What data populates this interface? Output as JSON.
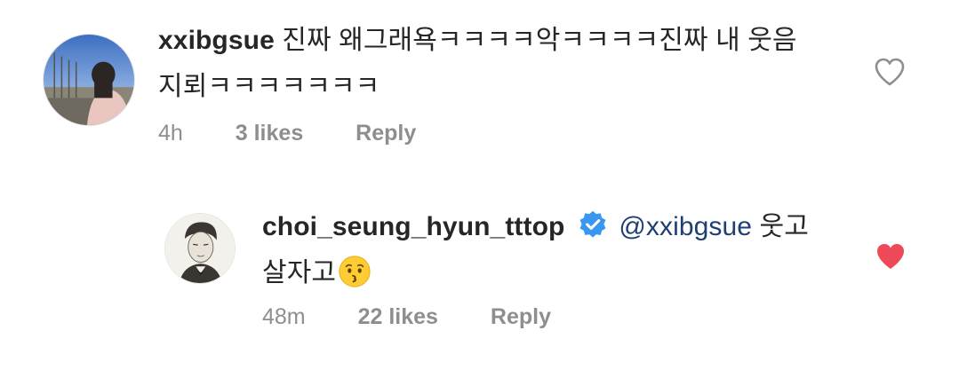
{
  "comments": [
    {
      "username": "xxibgsue",
      "text_line1": "진짜 왜그래욕ㅋㅋㅋㅋ악ㅋㅋㅋㅋ진짜 내 웃음",
      "text_line2": "지뢰ㅋㅋㅋㅋㅋㅋㅋ",
      "time": "4h",
      "likes": "3 likes",
      "reply": "Reply",
      "liked": false
    },
    {
      "username": "choi_seung_hyun_tttop",
      "verified": true,
      "mention": "@xxibgsue",
      "text_line1_suffix": " 웃고",
      "text_line2": "살자고",
      "emoji": "kissing-face",
      "time": "48m",
      "likes": "22 likes",
      "reply": "Reply",
      "liked": true
    }
  ],
  "colors": {
    "text": "#262626",
    "meta": "#8e8e8e",
    "mention": "#1e3f73",
    "verified": "#3897f0",
    "heart_liked": "#ed4956",
    "heart_outline": "#8e8e8e"
  }
}
